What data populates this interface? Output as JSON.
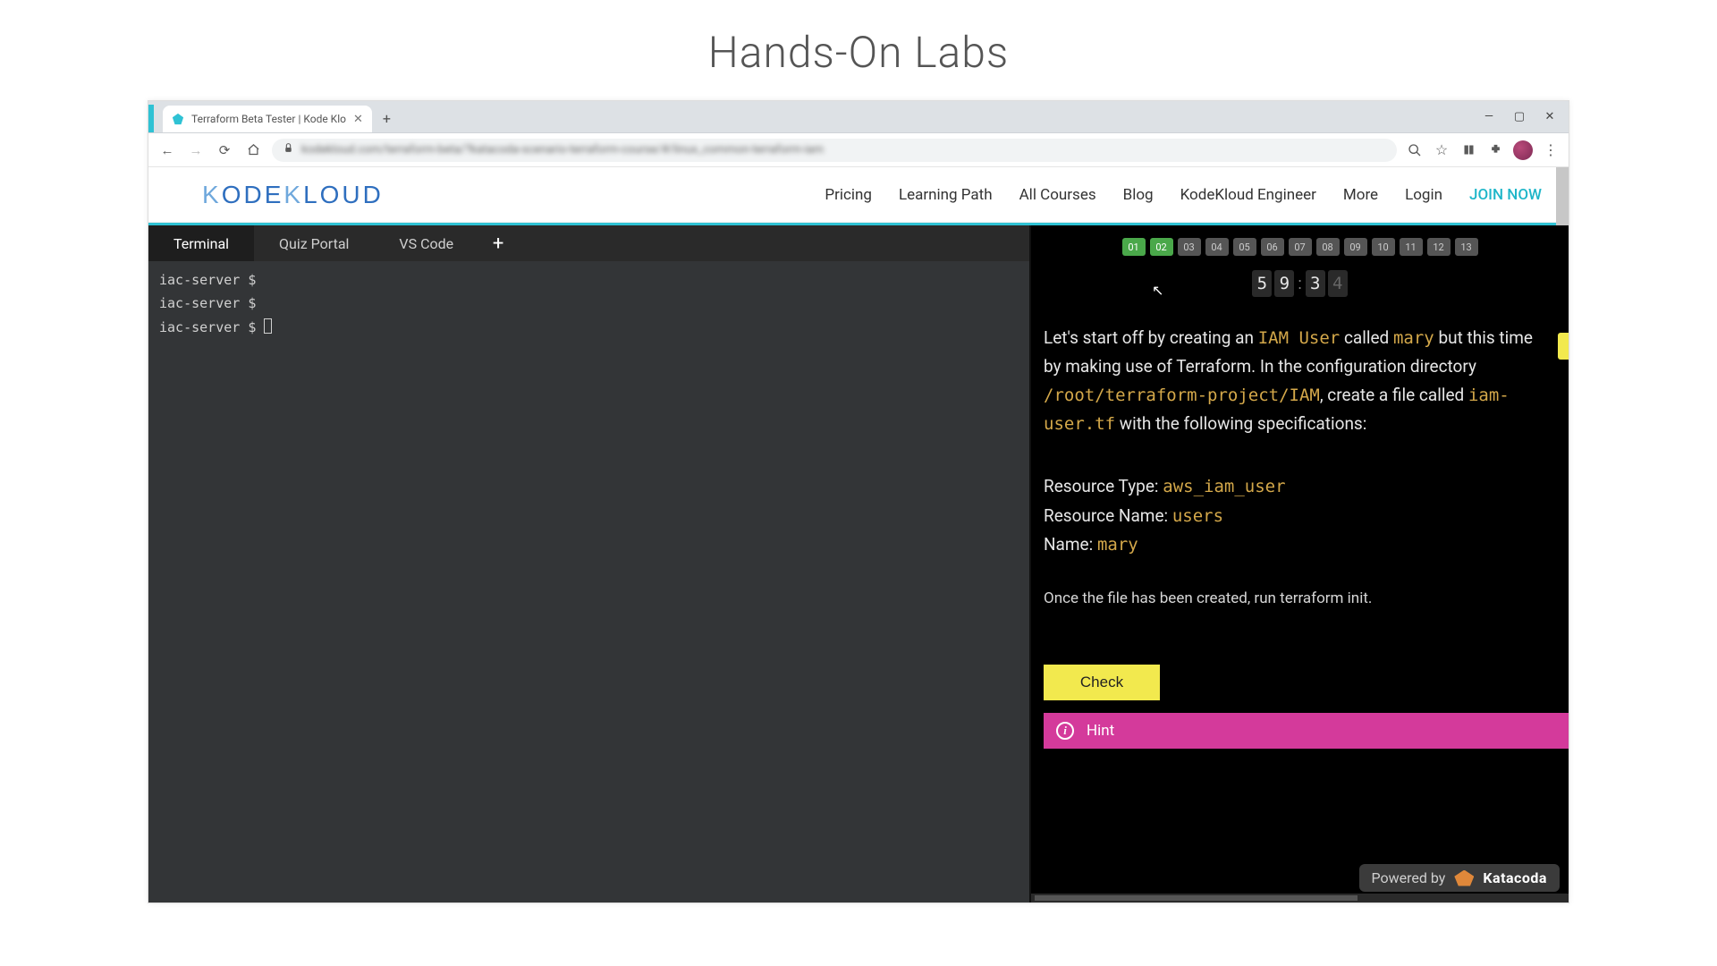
{
  "page_heading": "Hands-On Labs",
  "browser": {
    "tab_title": "Terraform Beta Tester | Kode Klo",
    "url_display": "kodekloud.com/terraform-beta/?katacoda-scenario-terraform-course/#/linux_common-terraform-iam",
    "window": {
      "min": "—",
      "max": "▢",
      "close": "✕"
    }
  },
  "site_nav": {
    "logo_parts": [
      "K",
      "ODE",
      "K",
      "LOUD"
    ],
    "links": [
      "Pricing",
      "Learning Path",
      "All Courses",
      "Blog",
      "KodeKloud Engineer",
      "More",
      "Login"
    ],
    "join": "JOIN NOW"
  },
  "lab_tabs": {
    "items": [
      "Terminal",
      "Quiz Portal",
      "VS Code"
    ],
    "active_index": 0
  },
  "terminal": {
    "prompt": "iac-server $",
    "lines": [
      "iac-server $",
      "iac-server $",
      "iac-server $ "
    ]
  },
  "steps": {
    "total": 13,
    "done_count": 2,
    "labels": [
      "01",
      "02",
      "03",
      "04",
      "05",
      "06",
      "07",
      "08",
      "09",
      "10",
      "11",
      "12",
      "13"
    ]
  },
  "timer": {
    "d1": "5",
    "d2": "9",
    "d3": "3",
    "d4": "4"
  },
  "instructions": {
    "p1_pre": "Let's start off by creating an ",
    "p1_code1": "IAM User",
    "p1_mid1": " called ",
    "p1_code2": "mary",
    "p1_mid2": " but this time by making use of Terraform. In the configuration directory ",
    "p1_code3": "/root/terraform-project/IAM",
    "p1_mid3": ", create a file called ",
    "p1_code4": "iam-user.tf",
    "p1_post": " with the following specifications:",
    "spec": {
      "rtype_label": "Resource Type: ",
      "rtype_value": "aws_iam_user",
      "rname_label": "Resource Name: ",
      "rname_value": "users",
      "name_label": "Name: ",
      "name_value": "mary"
    },
    "note": "Once the file has been created, run terraform init."
  },
  "buttons": {
    "check": "Check",
    "hint": "Hint"
  },
  "powered": {
    "prefix": "Powered by",
    "brand": "Katacoda"
  }
}
